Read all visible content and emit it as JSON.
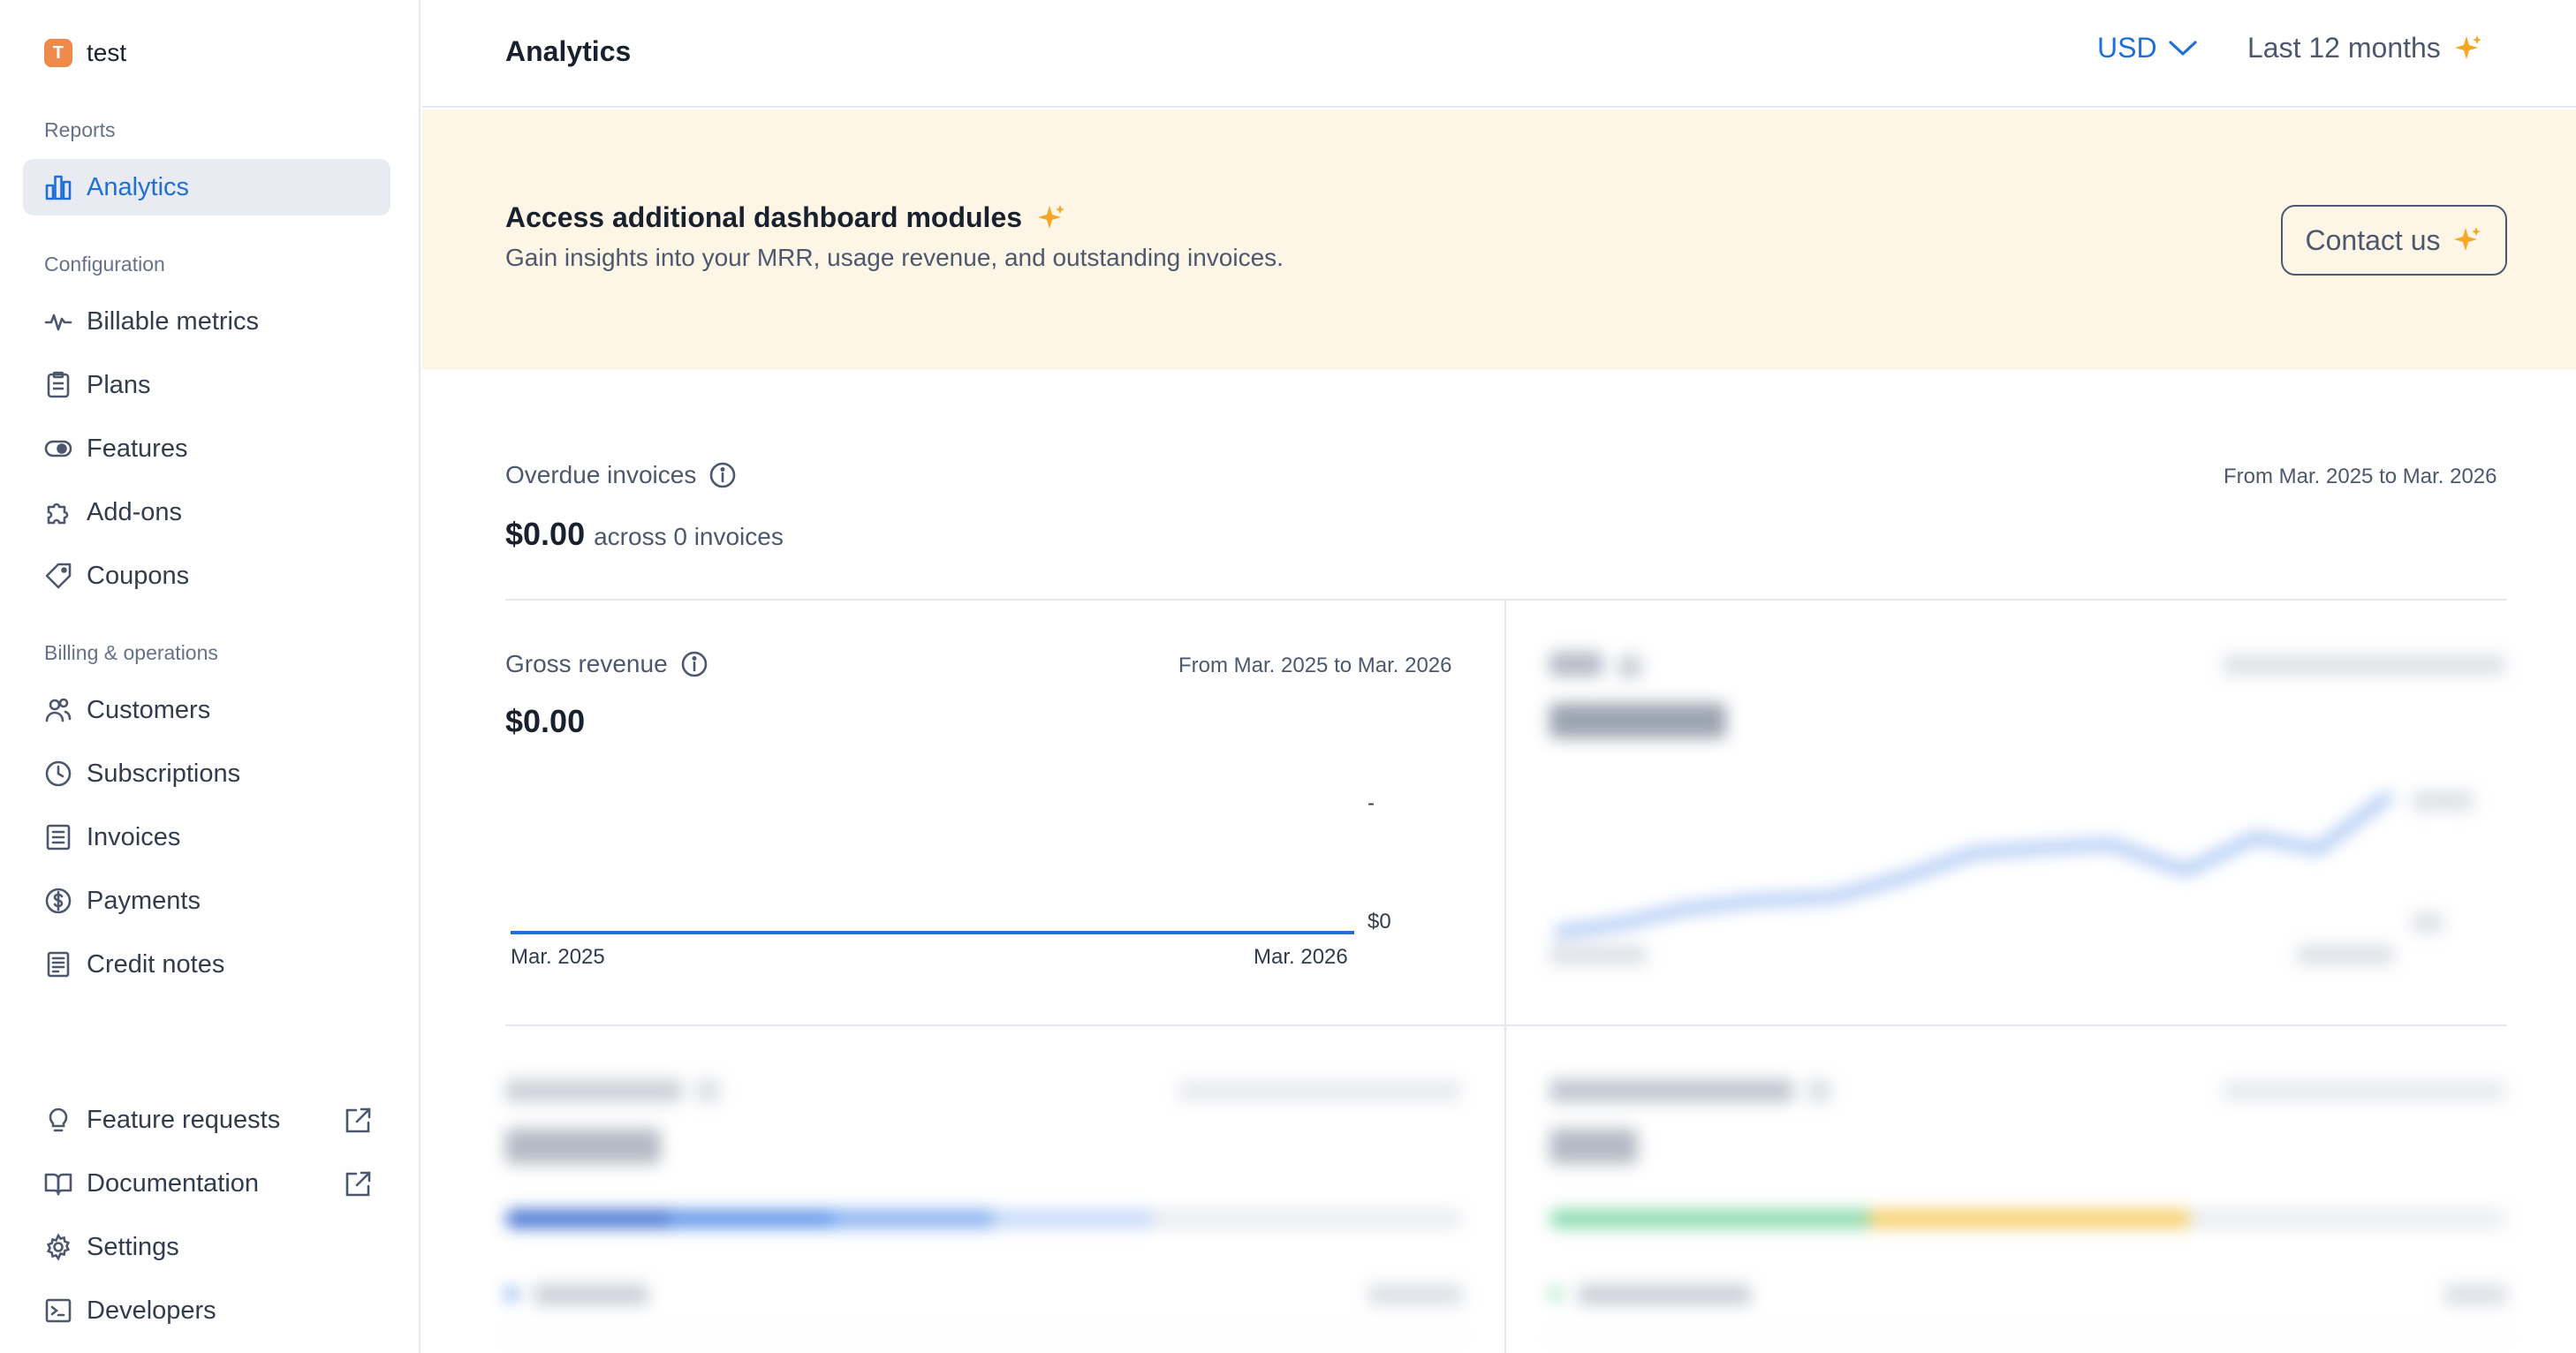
{
  "org": {
    "initial": "T",
    "name": "test"
  },
  "sidebar": {
    "reports_title": "Reports",
    "reports_items": [
      {
        "label": "Analytics",
        "icon": "bar-chart-icon"
      }
    ],
    "config_title": "Configuration",
    "config_items": [
      {
        "label": "Billable metrics",
        "icon": "pulse-icon"
      },
      {
        "label": "Plans",
        "icon": "clipboard-icon"
      },
      {
        "label": "Features",
        "icon": "toggle-icon"
      },
      {
        "label": "Add-ons",
        "icon": "puzzle-icon"
      },
      {
        "label": "Coupons",
        "icon": "tag-icon"
      }
    ],
    "billing_title": "Billing & operations",
    "billing_items": [
      {
        "label": "Customers",
        "icon": "users-icon"
      },
      {
        "label": "Subscriptions",
        "icon": "clock-icon"
      },
      {
        "label": "Invoices",
        "icon": "document-icon"
      },
      {
        "label": "Payments",
        "icon": "dollar-circle-icon"
      },
      {
        "label": "Credit notes",
        "icon": "receipt-icon"
      }
    ],
    "bottom_items": [
      {
        "label": "Feature requests",
        "icon": "lightbulb-icon"
      },
      {
        "label": "Documentation",
        "icon": "book-icon"
      },
      {
        "label": "Settings",
        "icon": "gear-icon"
      },
      {
        "label": "Developers",
        "icon": "terminal-icon"
      }
    ]
  },
  "header": {
    "title": "Analytics",
    "currency": "USD",
    "period": "Last 12 months"
  },
  "banner": {
    "title": "Access additional dashboard modules",
    "subtitle": "Gain insights into your MRR, usage revenue, and outstanding invoices.",
    "cta": "Contact us"
  },
  "overdue": {
    "title": "Overdue invoices",
    "range": "From Mar. 2025 to Mar. 2026",
    "value": "$0.00",
    "suffix": "across 0 invoices"
  },
  "gross_revenue": {
    "title": "Gross revenue",
    "range": "From Mar. 2025 to Mar. 2026",
    "value": "$0.00",
    "y_top": "-",
    "y_bottom": "$0",
    "x_start": "Mar. 2025",
    "x_end": "Mar. 2026"
  },
  "colors": {
    "accent": "#1f6fd9",
    "banner_bg": "#fdf6e6",
    "sparkle": "#f5a623"
  }
}
